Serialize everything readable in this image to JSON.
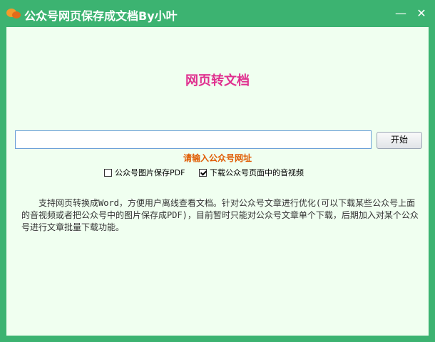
{
  "window": {
    "title": "公众号网页保存成文档By小叶",
    "minimize_glyph": "—",
    "close_glyph": "✕",
    "icon": "chat-bubbles-icon"
  },
  "main": {
    "headline": "网页转文档",
    "url_input": {
      "value": "",
      "placeholder": ""
    },
    "start_button": "开始",
    "hint": "请输入公众号网址",
    "options": [
      {
        "label": "公众号图片保存PDF",
        "checked": false
      },
      {
        "label": "下载公众号页面中的音视频",
        "checked": true
      }
    ],
    "description": "　　支持网页转换成Word，方便用户离线查看文档。针对公众号文章进行优化(可以下载某些公众号上面的音视频或者把公众号中的图片保存成PDF)，目前暂时只能对公众号文章单个下载，后期加入对某个公众号进行文章批量下载功能。"
  },
  "colors": {
    "titlebar": "#3cb371",
    "client_bg": "#f0fff0",
    "headline": "#e0308f",
    "hint": "#e05a00"
  }
}
